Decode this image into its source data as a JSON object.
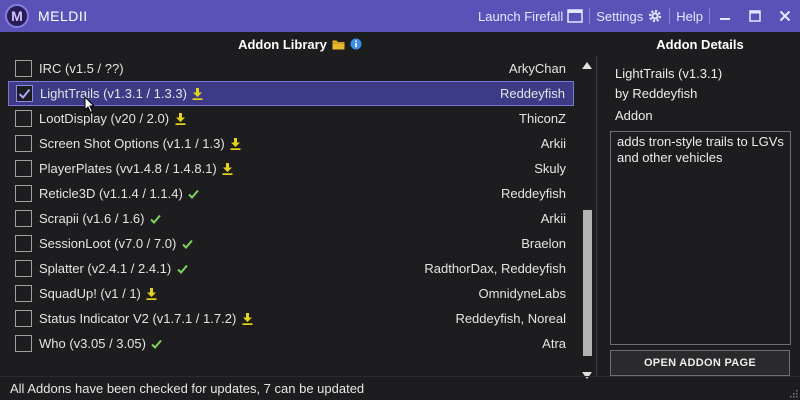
{
  "app": {
    "title": "MELDII",
    "logo_letter": "M",
    "brand_color": "#5b52b8"
  },
  "titlebar": {
    "launch_label": "Launch Firefall",
    "settings_label": "Settings",
    "help_label": "Help",
    "icons": [
      "window-icon",
      "gear-icon",
      "minimize-icon",
      "maximize-icon",
      "close-icon"
    ]
  },
  "library": {
    "title": "Addon Library",
    "icons": [
      "folder-icon",
      "info-icon"
    ],
    "status_legend": {
      "download": "update available",
      "check": "up to date"
    },
    "addons": [
      {
        "name": "IRC (v1.5 / ??)",
        "author": "ArkyChan",
        "status": "none",
        "checked": false,
        "selected": false
      },
      {
        "name": "LightTrails (v1.3.1 / 1.3.3)",
        "author": "Reddeyfish",
        "status": "download",
        "checked": true,
        "selected": true
      },
      {
        "name": "LootDisplay (v20 / 2.0)",
        "author": "ThiconZ",
        "status": "download",
        "checked": false,
        "selected": false
      },
      {
        "name": "Screen Shot Options (v1.1 / 1.3)",
        "author": "Arkii",
        "status": "download",
        "checked": false,
        "selected": false
      },
      {
        "name": "PlayerPlates (vv1.4.8 / 1.4.8.1)",
        "author": "Skuly",
        "status": "download",
        "checked": false,
        "selected": false
      },
      {
        "name": "Reticle3D (v1.1.4 / 1.1.4)",
        "author": "Reddeyfish",
        "status": "check",
        "checked": false,
        "selected": false
      },
      {
        "name": "Scrapii (v1.6 / 1.6)",
        "author": "Arkii",
        "status": "check",
        "checked": false,
        "selected": false
      },
      {
        "name": "SessionLoot (v7.0 / 7.0)",
        "author": "Braelon",
        "status": "check",
        "checked": false,
        "selected": false
      },
      {
        "name": "Splatter (v2.4.1 / 2.4.1)",
        "author": "RadthorDax, Reddeyfish",
        "status": "check",
        "checked": false,
        "selected": false
      },
      {
        "name": "SquadUp! (v1 / 1)",
        "author": "OmnidyneLabs",
        "status": "download",
        "checked": false,
        "selected": false
      },
      {
        "name": "Status Indicator V2 (v1.7.1 / 1.7.2)",
        "author": "Reddeyfish, Noreal",
        "status": "download",
        "checked": false,
        "selected": false
      },
      {
        "name": "Who (v3.05 / 3.05)",
        "author": "Atra",
        "status": "check",
        "checked": false,
        "selected": false
      }
    ]
  },
  "details": {
    "title": "Addon Details",
    "name": "LightTrails (v1.3.1)",
    "author": "by Reddeyfish",
    "type": "Addon",
    "description": "adds tron-style trails to LGVs and other vehicles",
    "open_button": "OPEN ADDON PAGE"
  },
  "statusbar": {
    "text": "All Addons have been checked for updates, 7 can be updated"
  },
  "colors": {
    "selected_row": "#3d3a86",
    "download_icon": "#e5d31c",
    "check_icon": "#7fd35a",
    "info_icon": "#3a8ee6",
    "folder_icon": "#e8b730"
  }
}
